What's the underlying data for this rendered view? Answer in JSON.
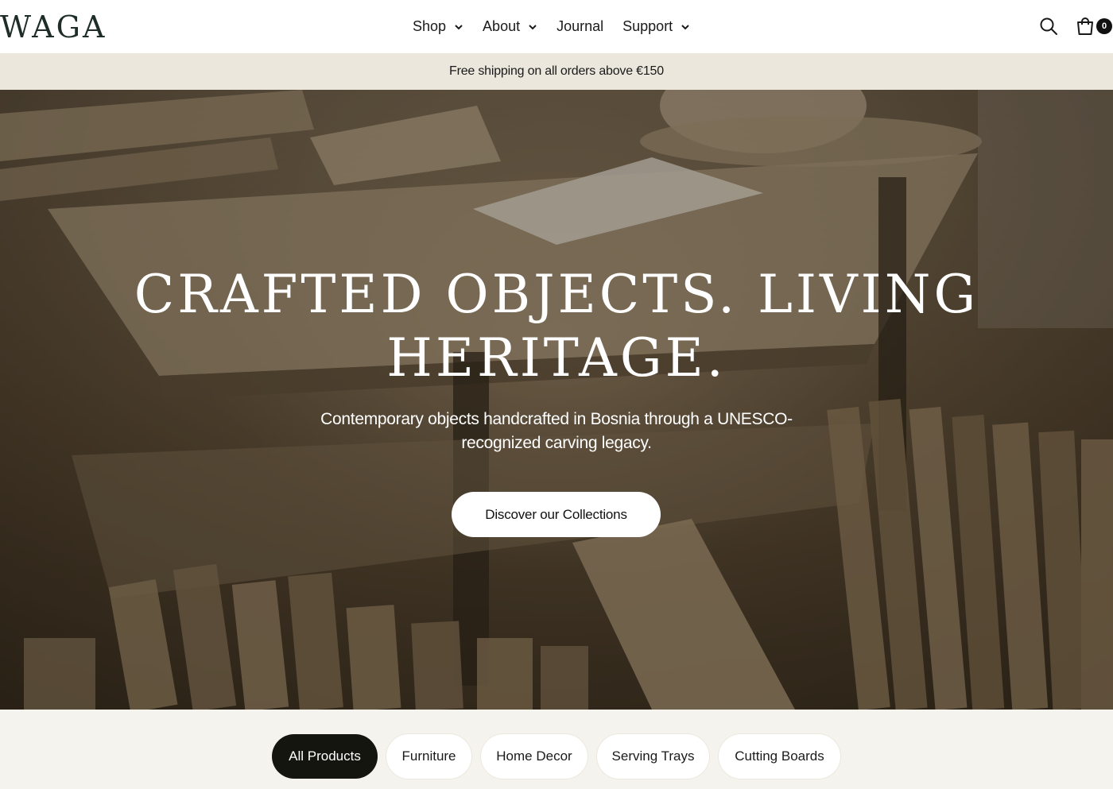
{
  "header": {
    "logo": "WAGA",
    "nav": [
      {
        "label": "Shop",
        "has_dropdown": true
      },
      {
        "label": "About",
        "has_dropdown": true
      },
      {
        "label": "Journal",
        "has_dropdown": false
      },
      {
        "label": "Support",
        "has_dropdown": true
      }
    ],
    "icons": {
      "search": "search-icon",
      "cart": "cart-icon"
    },
    "cart_count": "0"
  },
  "announcement": {
    "text": "Free shipping on all orders above €150"
  },
  "hero": {
    "title_line1": "CRAFTED OBJECTS. LIVING",
    "title_line2": "HERITAGE.",
    "subtitle": "Contemporary objects handcrafted in Bosnia through a UNESCO-recognized carving legacy.",
    "cta": "Discover our Collections"
  },
  "categories": {
    "items": [
      {
        "label": "All Products",
        "active": true
      },
      {
        "label": "Furniture",
        "active": false
      },
      {
        "label": "Home Decor",
        "active": false
      },
      {
        "label": "Serving Trays",
        "active": false
      },
      {
        "label": "Cutting Boards",
        "active": false
      }
    ]
  },
  "colors": {
    "announcement_bg": "#ebe7dd",
    "active_pill": "#15150f",
    "logo": "#1f2d28"
  }
}
